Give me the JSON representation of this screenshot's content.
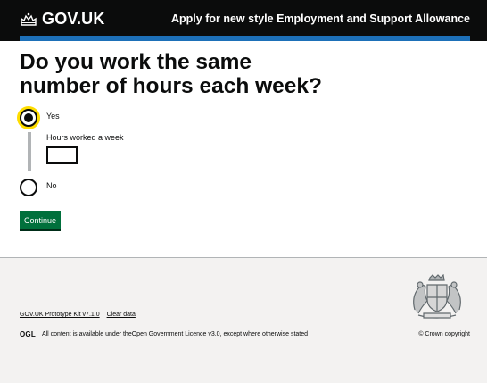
{
  "header": {
    "logo_text": "GOV.UK",
    "service_name": "Apply for new style Employment and Support Allowance"
  },
  "question": {
    "heading": "Do you work the same number of hours each week?",
    "options": [
      {
        "label": "Yes",
        "selected": true
      },
      {
        "label": "No",
        "selected": false
      }
    ],
    "conditional_label": "Hours worked a week",
    "conditional_value": ""
  },
  "continue_label": "Continue",
  "footer": {
    "prototype_link": "GOV.UK Prototype Kit v7.1.0",
    "clear_data_link": "Clear data",
    "ogl_logo": "OGL",
    "licence_prefix": "All content is available under the ",
    "licence_link": "Open Government Licence v3.0",
    "licence_suffix": ", except where otherwise stated",
    "copyright": "© Crown copyright"
  },
  "colors": {
    "header_bg": "#0b0c0c",
    "header_accent": "#1d70b8",
    "focus": "#ffdd00",
    "button": "#00703c",
    "footer_bg": "#f3f2f1"
  }
}
